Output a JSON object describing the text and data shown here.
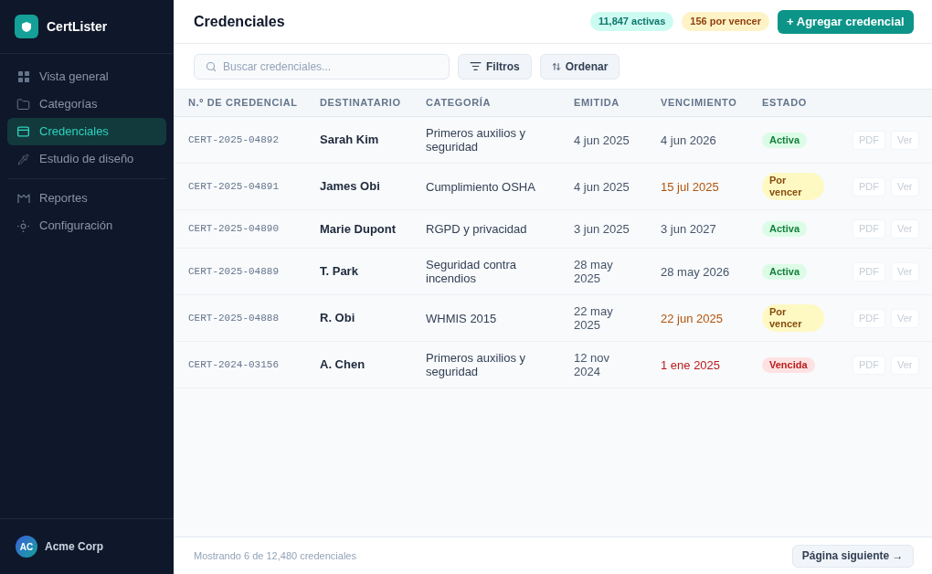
{
  "sidebar": {
    "brand": "CertLister",
    "sections": [
      {
        "items": [
          {
            "label": "Vista general",
            "selected": false
          },
          {
            "label": "Categorías",
            "selected": false
          },
          {
            "label": "Credenciales",
            "selected": true
          },
          {
            "label": "Estudio de diseño",
            "selected": false
          }
        ]
      },
      {
        "items": [
          {
            "label": "Reportes",
            "selected": false
          },
          {
            "label": "Configuración",
            "selected": false
          }
        ]
      }
    ],
    "account": {
      "initials": "AC",
      "name": "Acme Corp"
    }
  },
  "header": {
    "title": "Credenciales",
    "stats": [
      {
        "label": "11,847 activas",
        "kind": "active"
      },
      {
        "label": "156 por vencer",
        "kind": "expiring"
      }
    ],
    "primary_button": "+ Agregar credencial"
  },
  "toolbar": {
    "search": {
      "placeholder": "Buscar credenciales..."
    },
    "buttons": [
      {
        "label": "Filtros",
        "kind": "filter"
      },
      {
        "label": "Ordenar",
        "kind": "sort"
      }
    ]
  },
  "table": {
    "columns": [
      "N.º DE CREDENCIAL",
      "DESTINATARIO",
      "CATEGORÍA",
      "EMITIDA",
      "VENCIMIENTO",
      "ESTADO"
    ],
    "rows": [
      {
        "id": "CERT-2025-04892",
        "recipient": "Sarah Kim",
        "category": "Primeros auxilios y seguridad",
        "issued": "4 jun 2025",
        "expires": "4 jun 2026",
        "status": {
          "label": "Activa",
          "kind": "active"
        },
        "actions": [
          "PDF",
          "Ver"
        ]
      },
      {
        "id": "CERT-2025-04891",
        "recipient": "James Obi",
        "category": "Cumplimiento OSHA",
        "issued": "4 jun 2025",
        "expires": "15 jul 2025",
        "status": {
          "label": "Por vencer",
          "kind": "expiring"
        },
        "actions": [
          "PDF",
          "Ver"
        ]
      },
      {
        "id": "CERT-2025-04890",
        "recipient": "Marie Dupont",
        "category": "RGPD y privacidad",
        "issued": "3 jun 2025",
        "expires": "3 jun 2027",
        "status": {
          "label": "Activa",
          "kind": "active"
        },
        "actions": [
          "PDF",
          "Ver"
        ]
      },
      {
        "id": "CERT-2025-04889",
        "recipient": "T. Park",
        "category": "Seguridad contra incendios",
        "issued": "28 may 2025",
        "expires": "28 may 2026",
        "status": {
          "label": "Activa",
          "kind": "active"
        },
        "actions": [
          "PDF",
          "Ver"
        ]
      },
      {
        "id": "CERT-2025-04888",
        "recipient": "R. Obi",
        "category": "WHMIS 2015",
        "issued": "22 may 2025",
        "expires": "22 jun 2025",
        "status": {
          "label": "Por vencer",
          "kind": "expiring"
        },
        "actions": [
          "PDF",
          "Ver"
        ]
      },
      {
        "id": "CERT-2024-03156",
        "recipient": "A. Chen",
        "category": "Primeros auxilios y seguridad",
        "issued": "12 nov 2024",
        "expires": "1 ene 2025",
        "status": {
          "label": "Vencida",
          "kind": "expired"
        },
        "actions": [
          "PDF",
          "Ver"
        ]
      }
    ]
  },
  "footer": {
    "summary": "Mostrando 6 de 12,480 credenciales",
    "next_button": "Página siguiente →"
  }
}
